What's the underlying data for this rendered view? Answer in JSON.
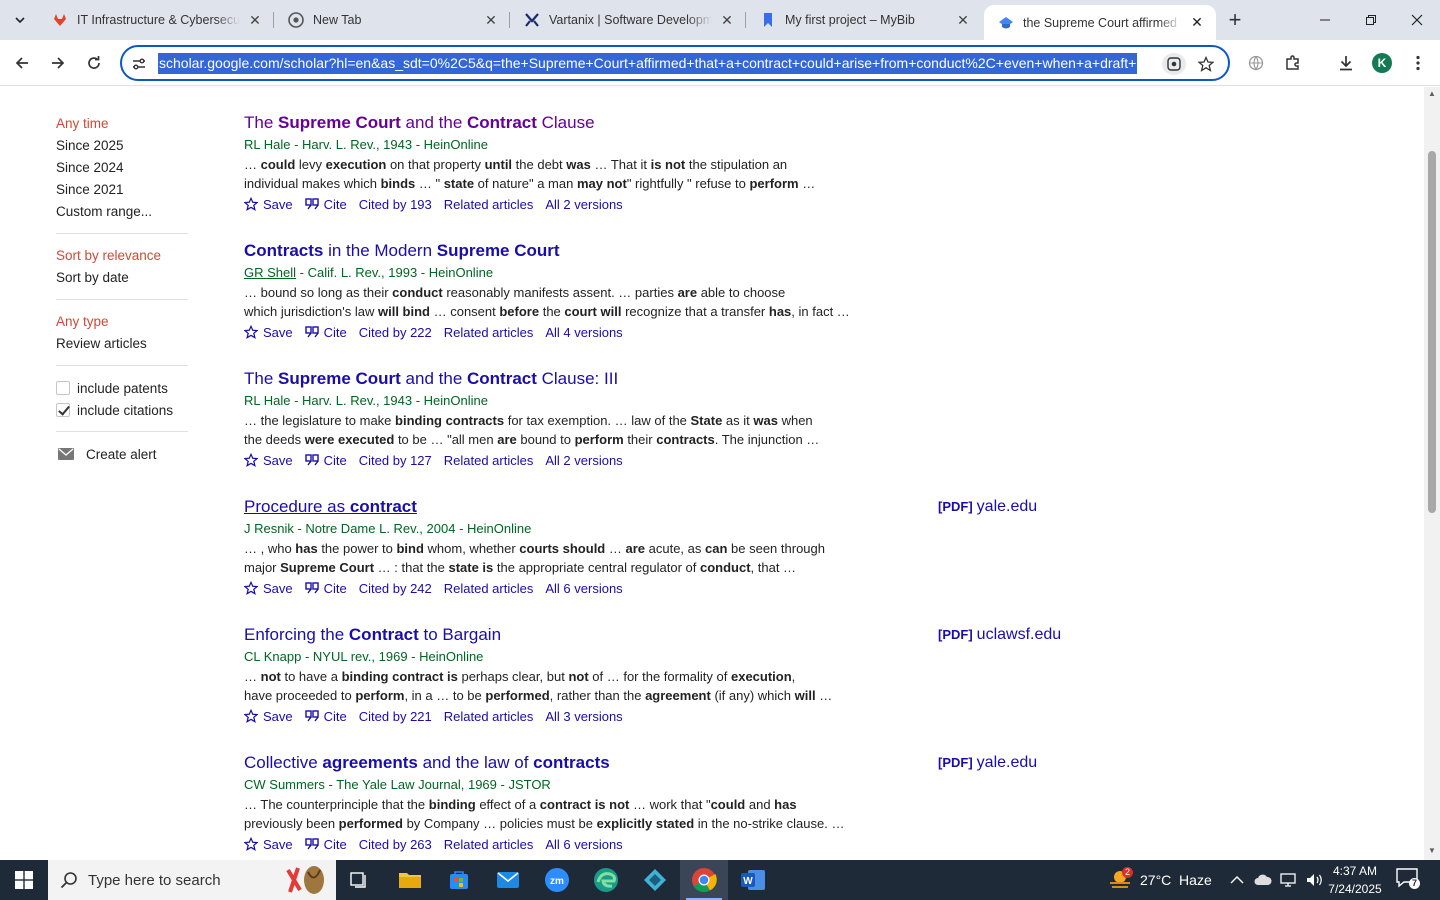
{
  "browser": {
    "tabs": [
      {
        "title": "IT Infrastructure & Cybersecurity",
        "icon": "gitlab-like-icon",
        "active": false
      },
      {
        "title": "New Tab",
        "icon": "chrome-icon",
        "active": false
      },
      {
        "title": "Vartanix | Software Development",
        "icon": "vartanix-icon",
        "active": false
      },
      {
        "title": "My first project – MyBib",
        "icon": "bookmark-icon",
        "active": false
      },
      {
        "title": "the Supreme Court affirmed that",
        "icon": "scholar-icon",
        "active": true
      }
    ],
    "url": "scholar.google.com/scholar?hl=en&as_sdt=0%2C5&q=the+Supreme+Court+affirmed+that+a+contract+could+arise+from+conduct%2C+even+when+a+draft+",
    "avatar_letter": "K"
  },
  "sidebar": {
    "time": [
      "Any time",
      "Since 2025",
      "Since 2024",
      "Since 2021",
      "Custom range..."
    ],
    "sort": [
      "Sort by relevance",
      "Sort by date"
    ],
    "type": [
      "Any type",
      "Review articles"
    ],
    "checks": [
      {
        "label": "include patents",
        "checked": false
      },
      {
        "label": "include citations",
        "checked": true
      }
    ],
    "alert": "Create alert"
  },
  "results": [
    {
      "title": [
        [
          "The ",
          false
        ],
        [
          "Supreme Court",
          true
        ],
        [
          " and the ",
          false
        ],
        [
          "Contract",
          true
        ],
        [
          " Clause",
          false
        ]
      ],
      "visited": true,
      "authors": "RL Hale - Harv. L. Rev., 1943 - HeinOnline",
      "snippet": [
        [
          [
            "… ",
            false
          ],
          [
            "could",
            true
          ],
          [
            " levy ",
            false
          ],
          [
            "execution",
            true
          ],
          [
            " on that property ",
            false
          ],
          [
            "until",
            true
          ],
          [
            " the debt ",
            false
          ],
          [
            "was",
            true
          ],
          [
            " … That it ",
            false
          ],
          [
            "is not",
            true
          ],
          [
            " the stipulation an",
            false
          ]
        ],
        [
          [
            "individual makes which ",
            false
          ],
          [
            "binds",
            true
          ],
          [
            " … \" ",
            false
          ],
          [
            "state",
            true
          ],
          [
            " of nature\" a man ",
            false
          ],
          [
            "may not",
            true
          ],
          [
            "\" rightfully \" refuse to ",
            false
          ],
          [
            "perform",
            true
          ],
          [
            " …",
            false
          ]
        ]
      ],
      "links": {
        "save": "Save",
        "cite": "Cite",
        "cited": "Cited by 193",
        "related": "Related articles",
        "versions": "All 2 versions"
      }
    },
    {
      "title": [
        [
          "Contracts",
          true
        ],
        [
          " in the Modern ",
          false
        ],
        [
          "Supreme Court",
          true
        ]
      ],
      "visited": false,
      "author_link": "GR Shell",
      "authors": " - Calif. L. Rev., 1993 - HeinOnline",
      "snippet": [
        [
          [
            "… bound so long as their ",
            false
          ],
          [
            "conduct",
            true
          ],
          [
            " reasonably manifests assent. … parties ",
            false
          ],
          [
            "are",
            true
          ],
          [
            " able to choose",
            false
          ]
        ],
        [
          [
            "which jurisdiction's law ",
            false
          ],
          [
            "will bind",
            true
          ],
          [
            " … consent ",
            false
          ],
          [
            "before",
            true
          ],
          [
            " the ",
            false
          ],
          [
            "court will",
            true
          ],
          [
            " recognize that a transfer ",
            false
          ],
          [
            "has",
            true
          ],
          [
            ", in fact …",
            false
          ]
        ]
      ],
      "links": {
        "save": "Save",
        "cite": "Cite",
        "cited": "Cited by 222",
        "related": "Related articles",
        "versions": "All 4 versions"
      }
    },
    {
      "title": [
        [
          "The ",
          false
        ],
        [
          "Supreme Court",
          true
        ],
        [
          " and the ",
          false
        ],
        [
          "Contract",
          true
        ],
        [
          " Clause: III",
          false
        ]
      ],
      "visited": false,
      "authors": "RL Hale - Harv. L. Rev., 1943 - HeinOnline",
      "snippet": [
        [
          [
            "… the legislature to make ",
            false
          ],
          [
            "binding contracts",
            true
          ],
          [
            " for tax exemption. … law of the ",
            false
          ],
          [
            "State",
            true
          ],
          [
            " as it ",
            false
          ],
          [
            "was",
            true
          ],
          [
            " when",
            false
          ]
        ],
        [
          [
            "the deeds ",
            false
          ],
          [
            "were executed",
            true
          ],
          [
            " to be … \"all men ",
            false
          ],
          [
            "are",
            true
          ],
          [
            " bound to ",
            false
          ],
          [
            "perform",
            true
          ],
          [
            " their ",
            false
          ],
          [
            "contracts",
            true
          ],
          [
            ". The injunction …",
            false
          ]
        ]
      ],
      "links": {
        "save": "Save",
        "cite": "Cite",
        "cited": "Cited by 127",
        "related": "Related articles",
        "versions": "All 2 versions"
      }
    },
    {
      "title": [
        [
          "Procedure as ",
          false
        ],
        [
          "contract",
          true
        ]
      ],
      "visited": false,
      "hover": true,
      "authors": "J Resnik - Notre Dame L. Rev., 2004 - HeinOnline",
      "snippet": [
        [
          [
            "… , who ",
            false
          ],
          [
            "has",
            true
          ],
          [
            " the power to ",
            false
          ],
          [
            "bind",
            true
          ],
          [
            " whom, whether ",
            false
          ],
          [
            "courts should",
            true
          ],
          [
            " … ",
            false
          ],
          [
            "are",
            true
          ],
          [
            " acute, as ",
            false
          ],
          [
            "can",
            true
          ],
          [
            " be seen through",
            false
          ]
        ],
        [
          [
            "major ",
            false
          ],
          [
            "Supreme Court",
            true
          ],
          [
            " … : that the ",
            false
          ],
          [
            "state is",
            true
          ],
          [
            " the appropriate central regulator of ",
            false
          ],
          [
            "conduct",
            true
          ],
          [
            ", that …",
            false
          ]
        ]
      ],
      "links": {
        "save": "Save",
        "cite": "Cite",
        "cited": "Cited by 242",
        "related": "Related articles",
        "versions": "All 6 versions"
      },
      "pdf": {
        "tag": "[PDF]",
        "domain": "yale.edu"
      }
    },
    {
      "title": [
        [
          "Enforcing the ",
          false
        ],
        [
          "Contract",
          true
        ],
        [
          " to Bargain",
          false
        ]
      ],
      "visited": false,
      "authors": "CL Knapp - NYUL rev., 1969 - HeinOnline",
      "snippet": [
        [
          [
            "… ",
            false
          ],
          [
            "not",
            true
          ],
          [
            " to have a ",
            false
          ],
          [
            "binding contract is",
            true
          ],
          [
            " perhaps clear, but ",
            false
          ],
          [
            "not",
            true
          ],
          [
            " of … for the formality of ",
            false
          ],
          [
            "execution",
            true
          ],
          [
            ",",
            false
          ]
        ],
        [
          [
            "have proceeded to ",
            false
          ],
          [
            "perform",
            true
          ],
          [
            ", in a … to be ",
            false
          ],
          [
            "performed",
            true
          ],
          [
            ", rather than the ",
            false
          ],
          [
            "agreement",
            true
          ],
          [
            " (if any) which ",
            false
          ],
          [
            "will",
            true
          ],
          [
            " …",
            false
          ]
        ]
      ],
      "links": {
        "save": "Save",
        "cite": "Cite",
        "cited": "Cited by 221",
        "related": "Related articles",
        "versions": "All 3 versions"
      },
      "pdf": {
        "tag": "[PDF]",
        "domain": "uclawsf.edu"
      }
    },
    {
      "title": [
        [
          "Collective ",
          false
        ],
        [
          "agreements",
          true
        ],
        [
          " and the law of ",
          false
        ],
        [
          "contracts",
          true
        ]
      ],
      "visited": false,
      "authors": "CW Summers - The Yale Law Journal, 1969 - JSTOR",
      "snippet": [
        [
          [
            "… The counterprinciple that the ",
            false
          ],
          [
            "binding",
            true
          ],
          [
            " effect of a ",
            false
          ],
          [
            "contract is not",
            true
          ],
          [
            " … work that \"",
            false
          ],
          [
            "could",
            true
          ],
          [
            " and ",
            false
          ],
          [
            "has",
            true
          ]
        ],
        [
          [
            "previously been ",
            false
          ],
          [
            "performed",
            true
          ],
          [
            " by Company … policies must be ",
            false
          ],
          [
            "explicitly stated",
            true
          ],
          [
            " in the no-strike clause. …",
            false
          ]
        ]
      ],
      "links": {
        "save": "Save",
        "cite": "Cite",
        "cited": "Cited by 263",
        "related": "Related articles",
        "versions": "All 6 versions"
      },
      "pdf": {
        "tag": "[PDF]",
        "domain": "yale.edu"
      }
    }
  ],
  "taskbar": {
    "search_placeholder": "Type here to search",
    "weather": "27°C  Haze",
    "weather_badge": "2",
    "time": "4:37 AM",
    "date": "7/24/2025",
    "notif_count": "7"
  },
  "colors": {
    "link": "#1a0dab",
    "visited": "#660099",
    "green": "#006621",
    "selected_filter": "#d14836",
    "url_highlight": "#3367d6"
  }
}
